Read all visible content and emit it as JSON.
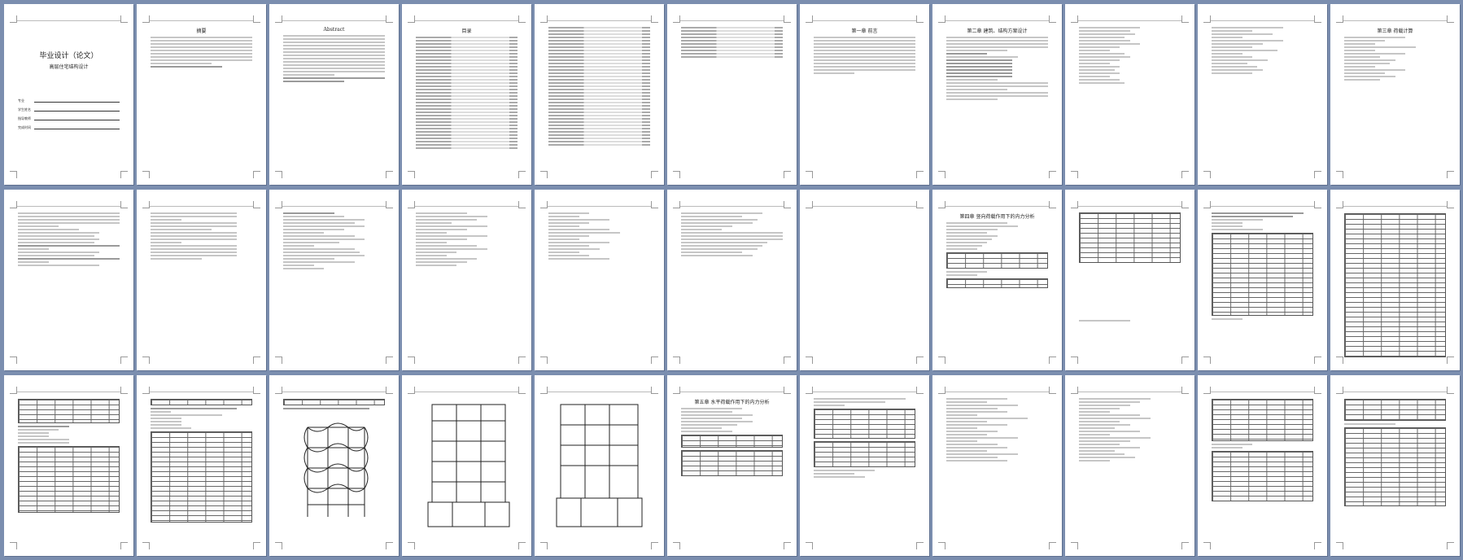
{
  "app": {
    "view": "multi-page thumbnail view",
    "background": "#7b8eaf"
  },
  "pages": [
    {
      "n": 1,
      "title": "毕业设计（论文）",
      "subtitle": "高层住宅结构设计"
    },
    {
      "n": 2,
      "title": "摘要"
    },
    {
      "n": 3,
      "title": "Abstract"
    },
    {
      "n": 4,
      "title": "目录"
    },
    {
      "n": 5,
      "title": ""
    },
    {
      "n": 6,
      "title": ""
    },
    {
      "n": 7,
      "title": "第一章 前言"
    },
    {
      "n": 8,
      "title": "第二章 建筑、结构方案设计"
    },
    {
      "n": 9,
      "title": ""
    },
    {
      "n": 10,
      "title": ""
    },
    {
      "n": 11,
      "title": "第三章 荷载计算"
    },
    {
      "n": 12,
      "title": ""
    },
    {
      "n": 13,
      "title": ""
    },
    {
      "n": 14,
      "title": ""
    },
    {
      "n": 15,
      "title": ""
    },
    {
      "n": 16,
      "title": ""
    },
    {
      "n": 17,
      "title": "第四章 竖向荷载作用下的内力分析"
    },
    {
      "n": 18,
      "title": ""
    },
    {
      "n": 19,
      "title": ""
    },
    {
      "n": 20,
      "title": ""
    },
    {
      "n": 21,
      "title": ""
    },
    {
      "n": 22,
      "title": ""
    },
    {
      "n": 23,
      "title": ""
    },
    {
      "n": 24,
      "title": ""
    },
    {
      "n": 25,
      "title": ""
    },
    {
      "n": 26,
      "title": "第五章 水平荷载作用下的内力分析"
    },
    {
      "n": 27,
      "title": ""
    },
    {
      "n": 28,
      "title": ""
    },
    {
      "n": 29,
      "title": ""
    },
    {
      "n": 30,
      "title": ""
    },
    {
      "n": 31,
      "title": ""
    },
    {
      "n": 32,
      "title": ""
    },
    {
      "n": 33,
      "title": ""
    }
  ],
  "cover_fields": [
    "专业",
    "学生姓名",
    "指导教师",
    "完成时间"
  ]
}
